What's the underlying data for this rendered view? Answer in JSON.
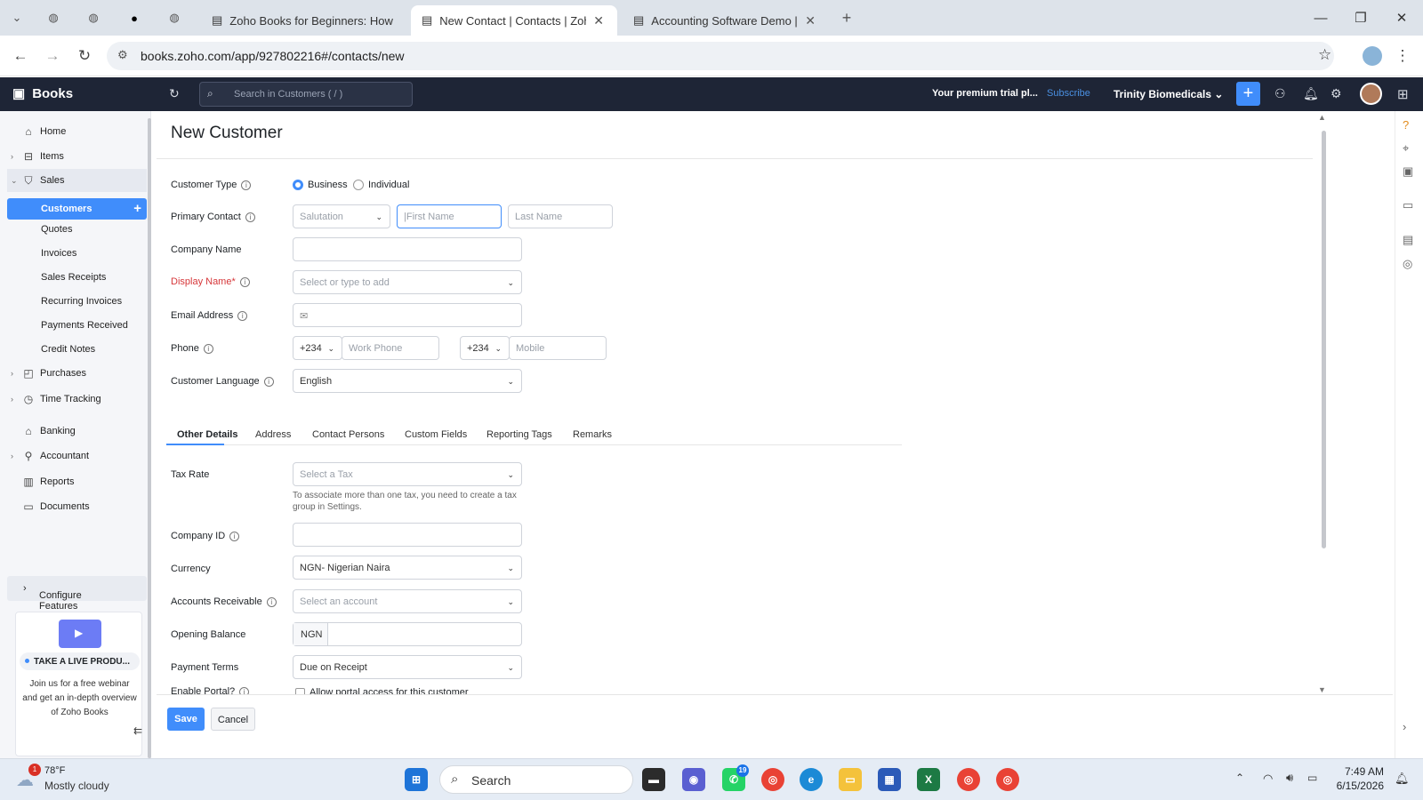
{
  "browser": {
    "tabs": [
      {
        "title": "Zoho Books for Beginners: How"
      },
      {
        "title": "New Contact | Contacts | Zoho"
      },
      {
        "title": "Accounting Software Demo | Fr"
      }
    ],
    "url": "books.zoho.com/app/927802216#/contacts/new"
  },
  "header": {
    "brand": "Books",
    "search_placeholder": "Search in Customers ( / )",
    "trial": "Your premium trial pl...",
    "subscribe": "Subscribe",
    "org": "Trinity Biomedicals"
  },
  "sidebar": {
    "home": "Home",
    "items": "Items",
    "sales": "Sales",
    "sales_sub": [
      "Customers",
      "Quotes",
      "Invoices",
      "Sales Receipts",
      "Recurring Invoices",
      "Payments Received",
      "Credit Notes"
    ],
    "purchases": "Purchases",
    "time_tracking": "Time Tracking",
    "banking": "Banking",
    "accountant": "Accountant",
    "reports": "Reports",
    "documents": "Documents",
    "configure": "Configure Features",
    "promo_title": "TAKE A LIVE PRODU...",
    "promo_text": "Join us for a free webinar and get an in-depth overview of Zoho Books"
  },
  "form": {
    "title": "New Customer",
    "customer_type_label": "Customer Type",
    "business": "Business",
    "individual": "Individual",
    "primary_contact_label": "Primary Contact",
    "salutation": "Salutation",
    "first_name_ph": "First Name",
    "last_name_ph": "Last Name",
    "company_name_label": "Company Name",
    "display_name_label": "Display Name*",
    "display_name_ph": "Select or type to add",
    "email_label": "Email Address",
    "phone_label": "Phone",
    "phone_code": "+234",
    "work_phone_ph": "Work Phone",
    "mobile_code": "+234",
    "mobile_ph": "Mobile",
    "language_label": "Customer Language",
    "language": "English"
  },
  "tabs": [
    "Other Details",
    "Address",
    "Contact Persons",
    "Custom Fields",
    "Reporting Tags",
    "Remarks"
  ],
  "other": {
    "tax_rate_label": "Tax Rate",
    "tax_ph": "Select a Tax",
    "tax_hint": "To associate more than one tax, you need to create a tax group in Settings.",
    "company_id_label": "Company ID",
    "currency_label": "Currency",
    "currency": "NGN- Nigerian Naira",
    "ar_label": "Accounts Receivable",
    "ar_ph": "Select an account",
    "opening_label": "Opening Balance",
    "opening_cur": "NGN",
    "terms_label": "Payment Terms",
    "terms": "Due on Receipt",
    "portal_label": "Enable Portal?",
    "portal_check": "Allow portal access for this customer"
  },
  "footer": {
    "save": "Save",
    "cancel": "Cancel"
  },
  "taskbar": {
    "temp": "78°F",
    "weather": "Mostly cloudy",
    "weather_badge": "1",
    "search": "Search",
    "whatsapp_badge": "19",
    "time": "7:49 AM",
    "date": "6/15/2026"
  },
  "colors": {
    "accent": "#408dfb",
    "header_bg": "#1e2536",
    "required": "#d6373a"
  }
}
